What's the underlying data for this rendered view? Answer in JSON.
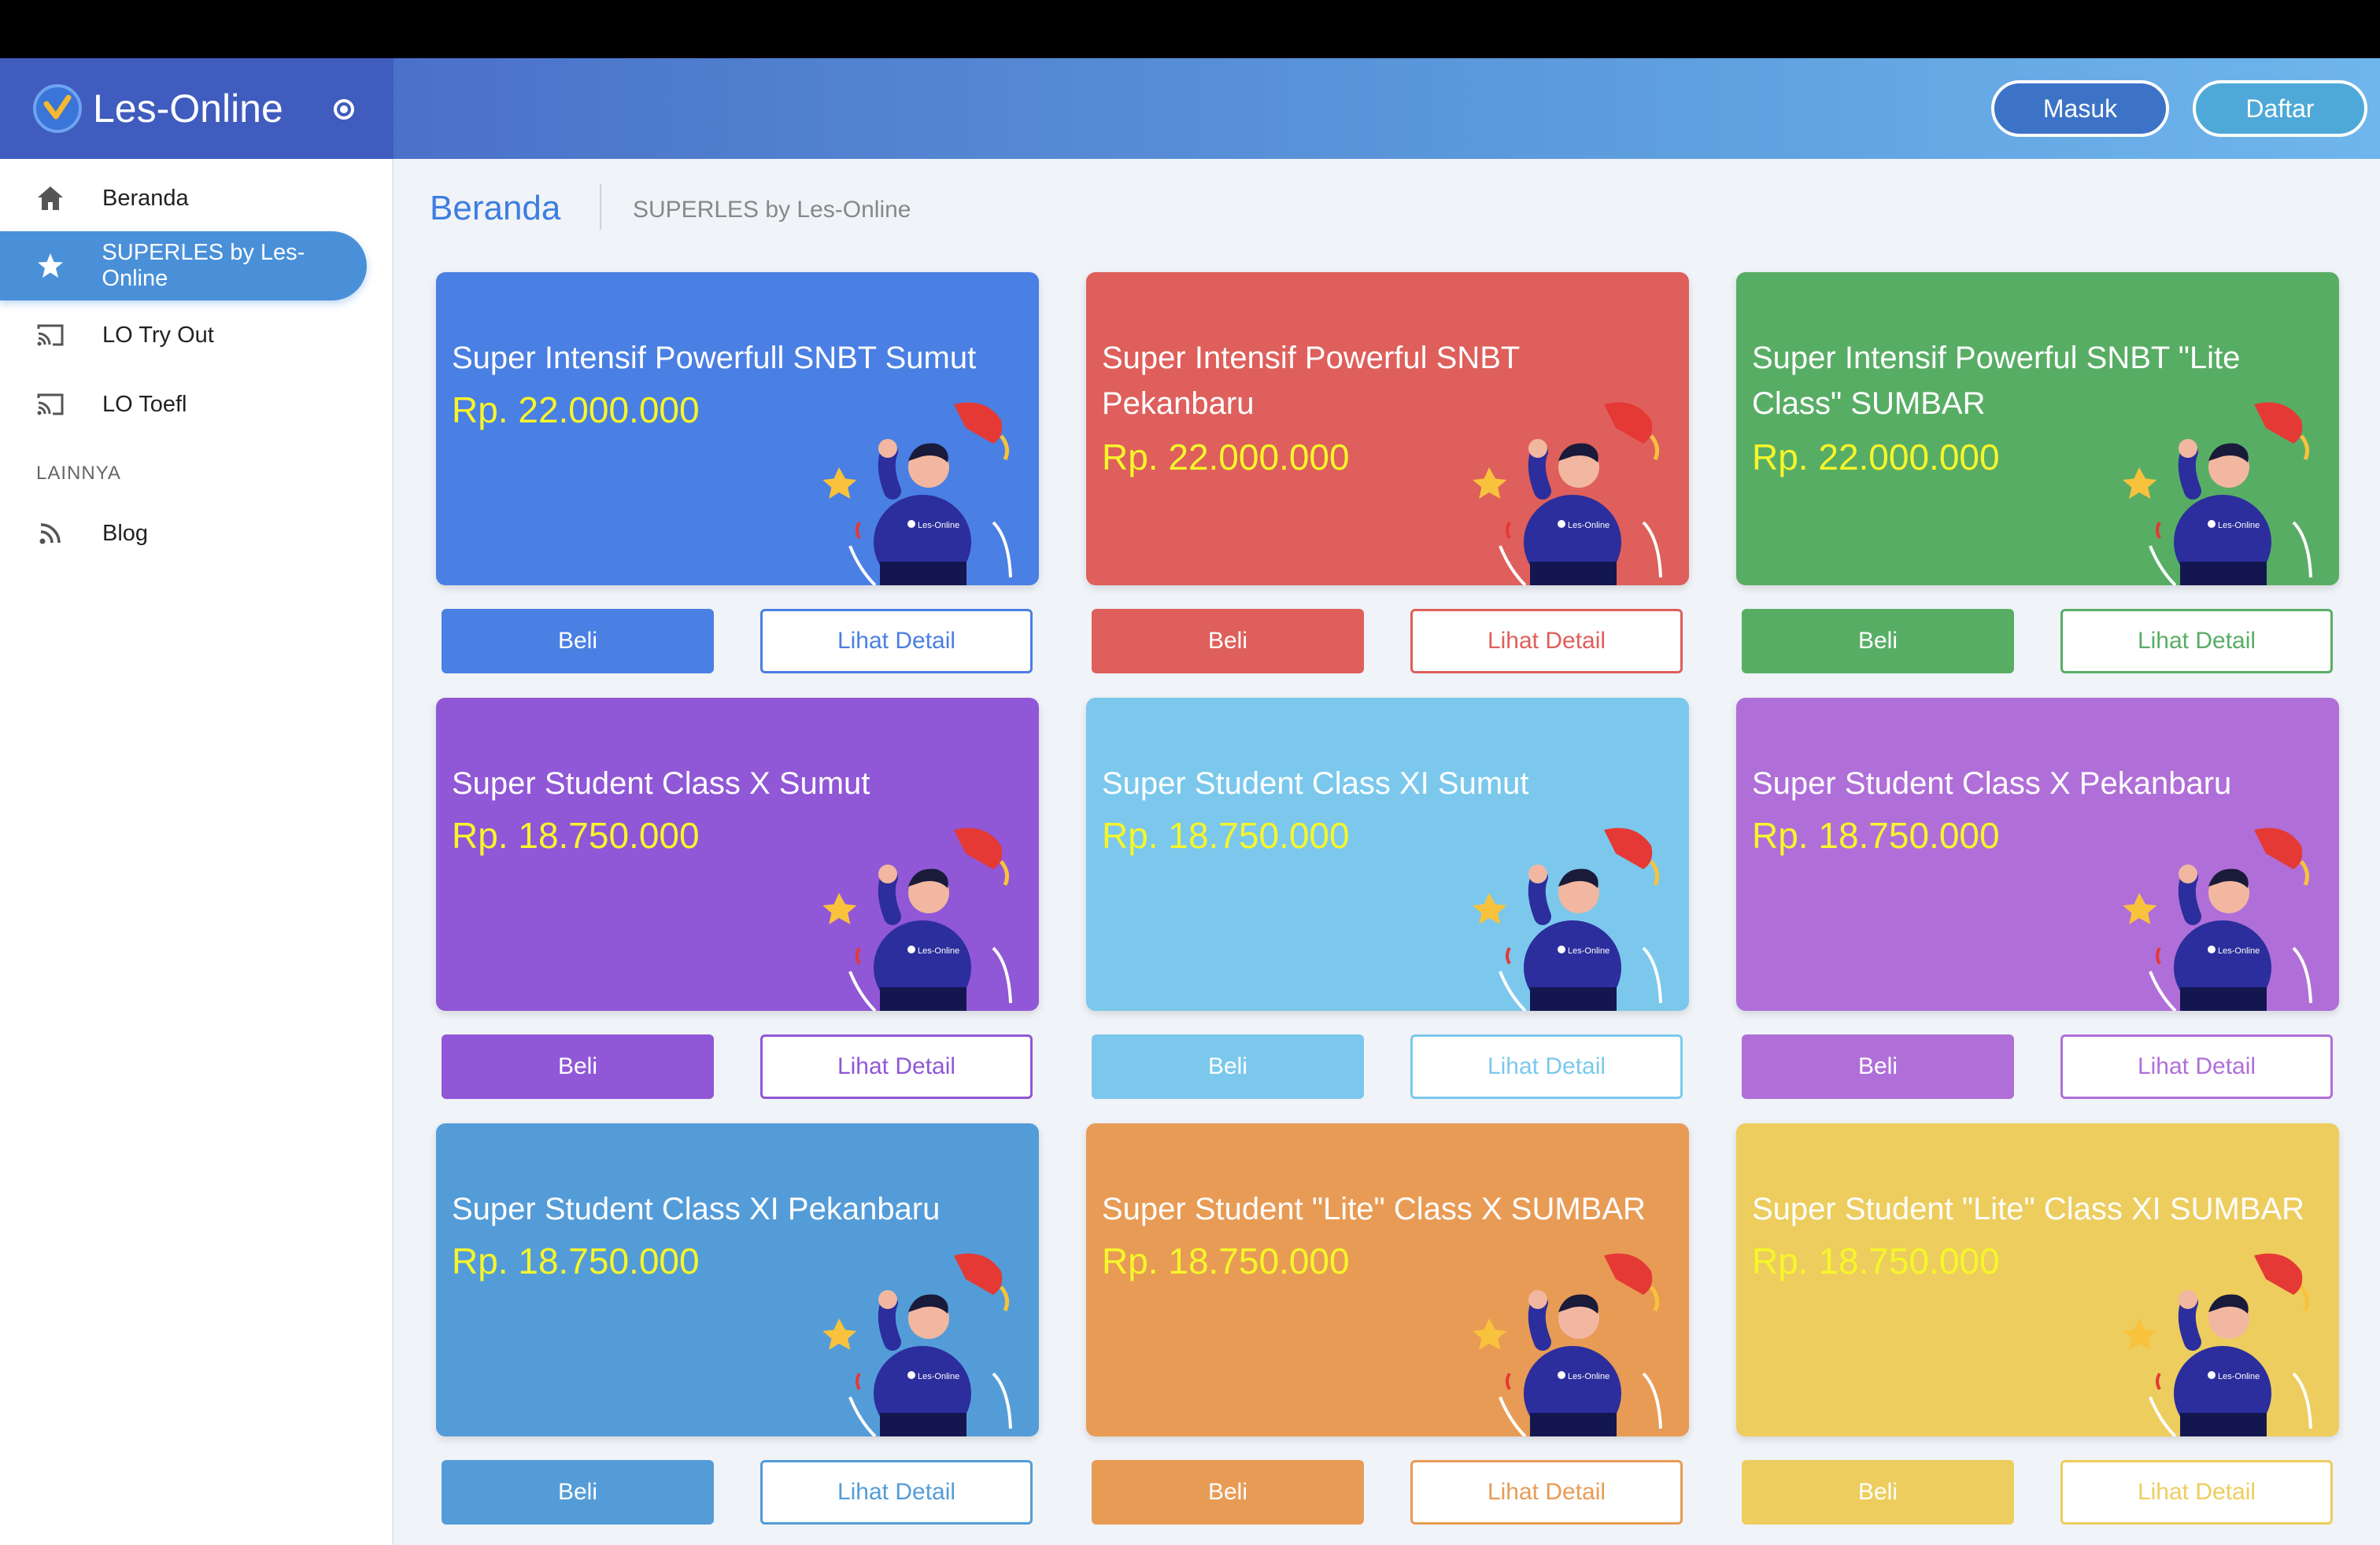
{
  "brand": {
    "name": "Les-Online"
  },
  "header": {
    "login_label": "Masuk",
    "register_label": "Daftar"
  },
  "sidebar": {
    "items": [
      {
        "label": "Beranda",
        "icon": "home-icon"
      },
      {
        "label": "SUPERLES by Les-Online",
        "icon": "star-icon"
      },
      {
        "label": "LO Try Out",
        "icon": "cast-icon"
      },
      {
        "label": "LO Toefl",
        "icon": "cast-icon"
      }
    ],
    "section_label": "LAINNYA",
    "extra_items": [
      {
        "label": "Blog",
        "icon": "rss-icon"
      }
    ]
  },
  "breadcrumb": {
    "title": "Beranda",
    "subtitle": "SUPERLES by Les-Online"
  },
  "cards": [
    {
      "title": "Super Intensif Powerfull SNBT Sumut",
      "price": "Rp. 22.000.000",
      "color": "#4a7fe3",
      "buy_label": "Beli",
      "detail_label": "Lihat Detail"
    },
    {
      "title": "Super Intensif Powerful SNBT Pekanbaru",
      "price": "Rp. 22.000.000",
      "color": "#de5f5b",
      "buy_label": "Beli",
      "detail_label": "Lihat Detail"
    },
    {
      "title": "Super Intensif Powerful SNBT \"Lite Class\" SUMBAR",
      "price": "Rp. 22.000.000",
      "color": "#58ad65",
      "buy_label": "Beli",
      "detail_label": "Lihat Detail"
    },
    {
      "title": "Super Student Class X Sumut",
      "price": "Rp. 18.750.000",
      "color": "#9057d6",
      "buy_label": "Beli",
      "detail_label": "Lihat Detail"
    },
    {
      "title": "Super Student Class XI Sumut",
      "price": "Rp. 18.750.000",
      "color": "#7bc8ec",
      "buy_label": "Beli",
      "detail_label": "Lihat Detail"
    },
    {
      "title": "Super Student Class X Pekanbaru",
      "price": "Rp. 18.750.000",
      "color": "#b06fd8",
      "buy_label": "Beli",
      "detail_label": "Lihat Detail"
    },
    {
      "title": "Super Student Class XI Pekanbaru",
      "price": "Rp. 18.750.000",
      "color": "#549cd8",
      "buy_label": "Beli",
      "detail_label": "Lihat Detail"
    },
    {
      "title": "Super Student \"Lite\" Class X SUMBAR",
      "price": "Rp. 18.750.000",
      "color": "#e89b55",
      "buy_label": "Beli",
      "detail_label": "Lihat Detail"
    },
    {
      "title": "Super Student \"Lite\" Class XI SUMBAR",
      "price": "Rp. 18.750.000",
      "color": "#edcd5e",
      "buy_label": "Beli",
      "detail_label": "Lihat Detail"
    }
  ]
}
